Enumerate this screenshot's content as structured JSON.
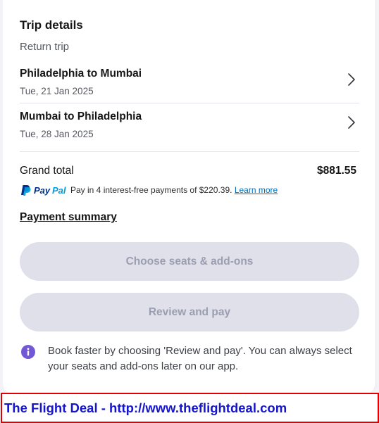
{
  "trip": {
    "title": "Trip details",
    "subtitle": "Return trip",
    "legs": [
      {
        "route": "Philadelphia to Mumbai",
        "date": "Tue, 21 Jan 2025"
      },
      {
        "route": "Mumbai to Philadelphia",
        "date": "Tue, 28 Jan 2025"
      }
    ]
  },
  "total": {
    "label": "Grand total",
    "value": "$881.55"
  },
  "paypal": {
    "brand_pay": "Pay",
    "brand_pal": "Pal",
    "text": "Pay in 4 interest-free payments of $220.39.",
    "learn_more": "Learn more",
    "colors": {
      "dark": "#003087",
      "light": "#009cde"
    }
  },
  "payment_summary": "Payment summary",
  "buttons": {
    "choose_seats": "Choose seats & add-ons",
    "review_pay": "Review and pay"
  },
  "info": {
    "icon": "info-icon",
    "text": "Book faster by choosing 'Review and pay'. You can always select your seats and add-ons later on our app."
  },
  "banner": {
    "text": "The Flight Deal - http://www.theflightdeal.com"
  },
  "colors": {
    "accent": "#7358d6",
    "disabled_button_bg": "#dfe0ea",
    "banner_border": "#e00000",
    "banner_text": "#1515cc"
  }
}
